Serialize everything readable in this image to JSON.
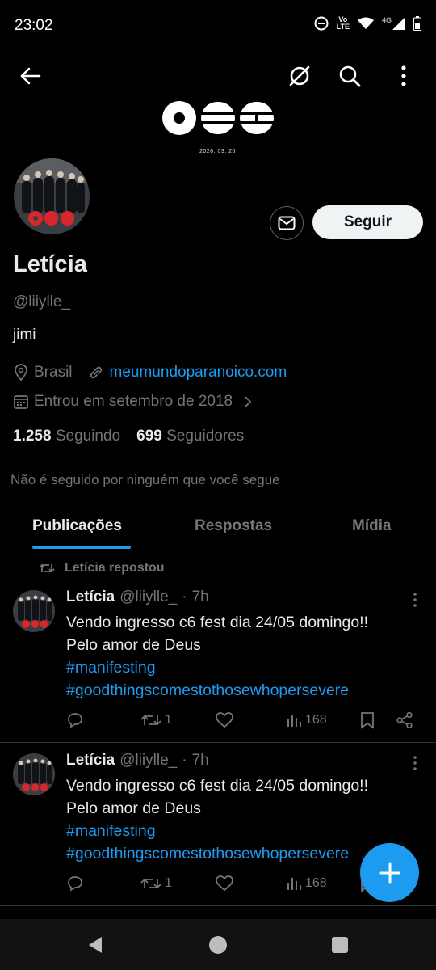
{
  "status_bar": {
    "time": "23:02",
    "volte": "Vo",
    "lte": "LTE",
    "network": "4G"
  },
  "header": {
    "back_icon": "arrow-left-icon",
    "icons": [
      "hide-icon",
      "search-icon",
      "more-vertical-icon"
    ]
  },
  "banner": {
    "date": "2026. 03. 20"
  },
  "profile": {
    "name": "Letícia",
    "handle": "@liiylle_",
    "bio": "jimi",
    "location": "Brasil",
    "website": "meumundoparanoico.com",
    "joined": "Entrou em setembro de 2018",
    "following_count": "1.258",
    "following_label": "Seguindo",
    "followers_count": "699",
    "followers_label": "Seguidores",
    "followed_by": "Não é seguido por ninguém que você segue",
    "follow_label": "Seguir"
  },
  "tabs": [
    {
      "label": "Publicações"
    },
    {
      "label": "Respostas"
    },
    {
      "label": "Mídia"
    }
  ],
  "repost_label": "Letícia repostou",
  "posts": [
    {
      "name": "Letícia",
      "handle": "@liiylle_",
      "dot": "·",
      "time": "7h",
      "line1": "Vendo ingresso c6 fest dia 24/05 domingo!!",
      "line2": "Pelo amor de Deus",
      "hashtag1": "#manifesting",
      "hashtag2": "#goodthingscomestothosewhopersevere",
      "reposts": "1",
      "views": "168"
    },
    {
      "name": "Letícia",
      "handle": "@liiylle_",
      "dot": "·",
      "time": "7h",
      "line1": "Vendo ingresso c6 fest dia 24/05 domingo!!",
      "line2": "Pelo amor de Deus",
      "hashtag1": "#manifesting",
      "hashtag2": "#goodthingscomestothosewhopersevere",
      "reposts": "1",
      "views": "168"
    }
  ],
  "colors": {
    "accent": "#1d9bf0",
    "background": "#000000",
    "muted": "#71767b"
  }
}
